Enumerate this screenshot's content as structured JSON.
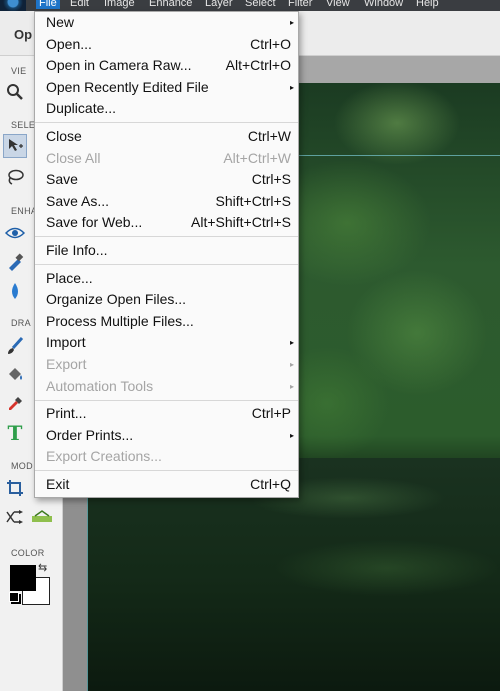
{
  "menubar": {
    "items": [
      "File",
      "Edit",
      "Image",
      "Enhance",
      "Layer",
      "Select",
      "Filter",
      "View",
      "Window",
      "Help"
    ]
  },
  "topbar": {
    "partial_label": "Op"
  },
  "left_panel": {
    "section_labels": [
      "VIE",
      "SELE",
      "ENHA",
      "DRA",
      "MOD",
      "COLOR"
    ]
  },
  "colors": {
    "foreground": "#000000",
    "background": "#ffffff",
    "menu_highlight": "#1e74c8"
  },
  "file_menu": {
    "items": [
      {
        "label": "New",
        "shortcut": "",
        "submenu": true,
        "disabled": false
      },
      {
        "label": "Open...",
        "shortcut": "Ctrl+O",
        "submenu": false,
        "disabled": false
      },
      {
        "label": "Open in Camera Raw...",
        "shortcut": "Alt+Ctrl+O",
        "submenu": false,
        "disabled": false
      },
      {
        "label": "Open Recently Edited File",
        "shortcut": "",
        "submenu": true,
        "disabled": false
      },
      {
        "label": "Duplicate...",
        "shortcut": "",
        "submenu": false,
        "disabled": false
      },
      {
        "label": "Close",
        "shortcut": "Ctrl+W",
        "submenu": false,
        "disabled": false
      },
      {
        "label": "Close All",
        "shortcut": "Alt+Ctrl+W",
        "submenu": false,
        "disabled": true
      },
      {
        "label": "Save",
        "shortcut": "Ctrl+S",
        "submenu": false,
        "disabled": false
      },
      {
        "label": "Save As...",
        "shortcut": "Shift+Ctrl+S",
        "submenu": false,
        "disabled": false
      },
      {
        "label": "Save for Web...",
        "shortcut": "Alt+Shift+Ctrl+S",
        "submenu": false,
        "disabled": false
      },
      {
        "label": "File Info...",
        "shortcut": "",
        "submenu": false,
        "disabled": false
      },
      {
        "label": "Place...",
        "shortcut": "",
        "submenu": false,
        "disabled": false
      },
      {
        "label": "Organize Open Files...",
        "shortcut": "",
        "submenu": false,
        "disabled": false
      },
      {
        "label": "Process Multiple Files...",
        "shortcut": "",
        "submenu": false,
        "disabled": false
      },
      {
        "label": "Import",
        "shortcut": "",
        "submenu": true,
        "disabled": false
      },
      {
        "label": "Export",
        "shortcut": "",
        "submenu": true,
        "disabled": true
      },
      {
        "label": "Automation Tools",
        "shortcut": "",
        "submenu": true,
        "disabled": true
      },
      {
        "label": "Print...",
        "shortcut": "Ctrl+P",
        "submenu": false,
        "disabled": false
      },
      {
        "label": "Order Prints...",
        "shortcut": "",
        "submenu": true,
        "disabled": false
      },
      {
        "label": "Export Creations...",
        "shortcut": "",
        "submenu": false,
        "disabled": true
      },
      {
        "label": "Exit",
        "shortcut": "Ctrl+Q",
        "submenu": false,
        "disabled": false
      }
    ]
  }
}
